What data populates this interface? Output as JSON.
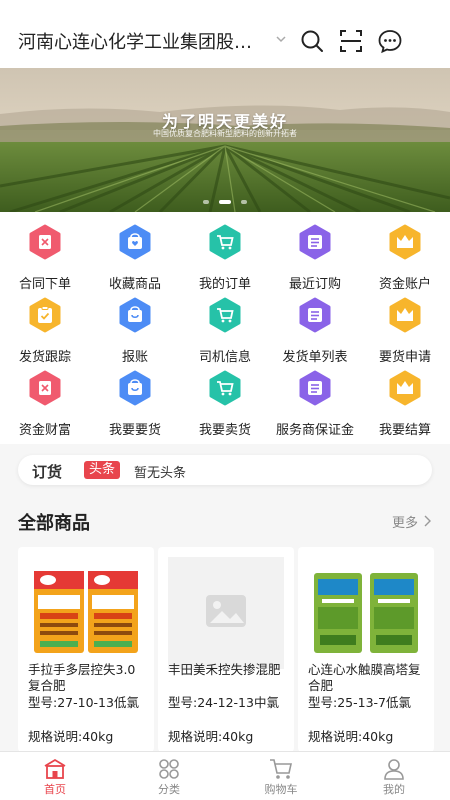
{
  "header": {
    "company_name": "河南心连心化学工业集团股份有限公司",
    "icons": [
      "chevron-down-icon",
      "search-icon",
      "scan-icon",
      "message-icon"
    ]
  },
  "banner": {
    "title": "为了明天更美好",
    "subtitle": "中国优质复合肥料新型肥料的创新开拓者"
  },
  "grid": {
    "items": [
      {
        "label": "合同下单",
        "icon": "contract-icon",
        "color": "#f05a6e"
      },
      {
        "label": "收藏商品",
        "icon": "favorite-bag-icon",
        "color": "#4d8cf5"
      },
      {
        "label": "我的订单",
        "icon": "cart-icon",
        "color": "#26c2a8"
      },
      {
        "label": "最近订购",
        "icon": "list-icon",
        "color": "#8a63e8"
      },
      {
        "label": "资金账户",
        "icon": "crown-icon",
        "color": "#f7b52c"
      },
      {
        "label": "发货跟踪",
        "icon": "clipboard-icon",
        "color": "#f7b52c"
      },
      {
        "label": "报账",
        "icon": "bag-icon",
        "color": "#4d8cf5"
      },
      {
        "label": "司机信息",
        "icon": "cart-icon",
        "color": "#26c2a8"
      },
      {
        "label": "发货单列表",
        "icon": "list-icon",
        "color": "#8a63e8"
      },
      {
        "label": "要货申请",
        "icon": "crown-icon",
        "color": "#f7b52c"
      },
      {
        "label": "资金财富",
        "icon": "contract-icon",
        "color": "#f05a6e"
      },
      {
        "label": "我要要货",
        "icon": "bag-icon",
        "color": "#4d8cf5"
      },
      {
        "label": "我要卖货",
        "icon": "cart-icon",
        "color": "#26c2a8"
      },
      {
        "label": "服务商保证金",
        "icon": "list-icon",
        "color": "#8a63e8"
      },
      {
        "label": "我要结算",
        "icon": "crown-icon",
        "color": "#f7b52c"
      }
    ]
  },
  "news": {
    "brand": "订货",
    "badge": "头条",
    "text": "暂无头条"
  },
  "products_section": {
    "title": "全部商品",
    "more": "更多"
  },
  "products": [
    {
      "name": "手拉手多层控失3.0复合肥",
      "model": "型号:27-10-13低氯",
      "spec": "规格说明:40kg"
    },
    {
      "name": "丰田美禾控失掺混肥",
      "model": "型号:24-12-13中氯",
      "spec": "规格说明:40kg"
    },
    {
      "name": "心连心水触膜高塔复合肥",
      "model": "型号:25-13-7低氯",
      "spec": "规格说明:40kg"
    }
  ],
  "tabbar": {
    "tabs": [
      {
        "label": "首页",
        "icon": "home-icon",
        "active": true
      },
      {
        "label": "分类",
        "icon": "category-icon",
        "active": false
      },
      {
        "label": "购物车",
        "icon": "cart-icon",
        "active": false
      },
      {
        "label": "我的",
        "icon": "user-icon",
        "active": false
      }
    ]
  },
  "colors": {
    "accent": "#e8454d",
    "brand_green": "#3f9c3a"
  }
}
